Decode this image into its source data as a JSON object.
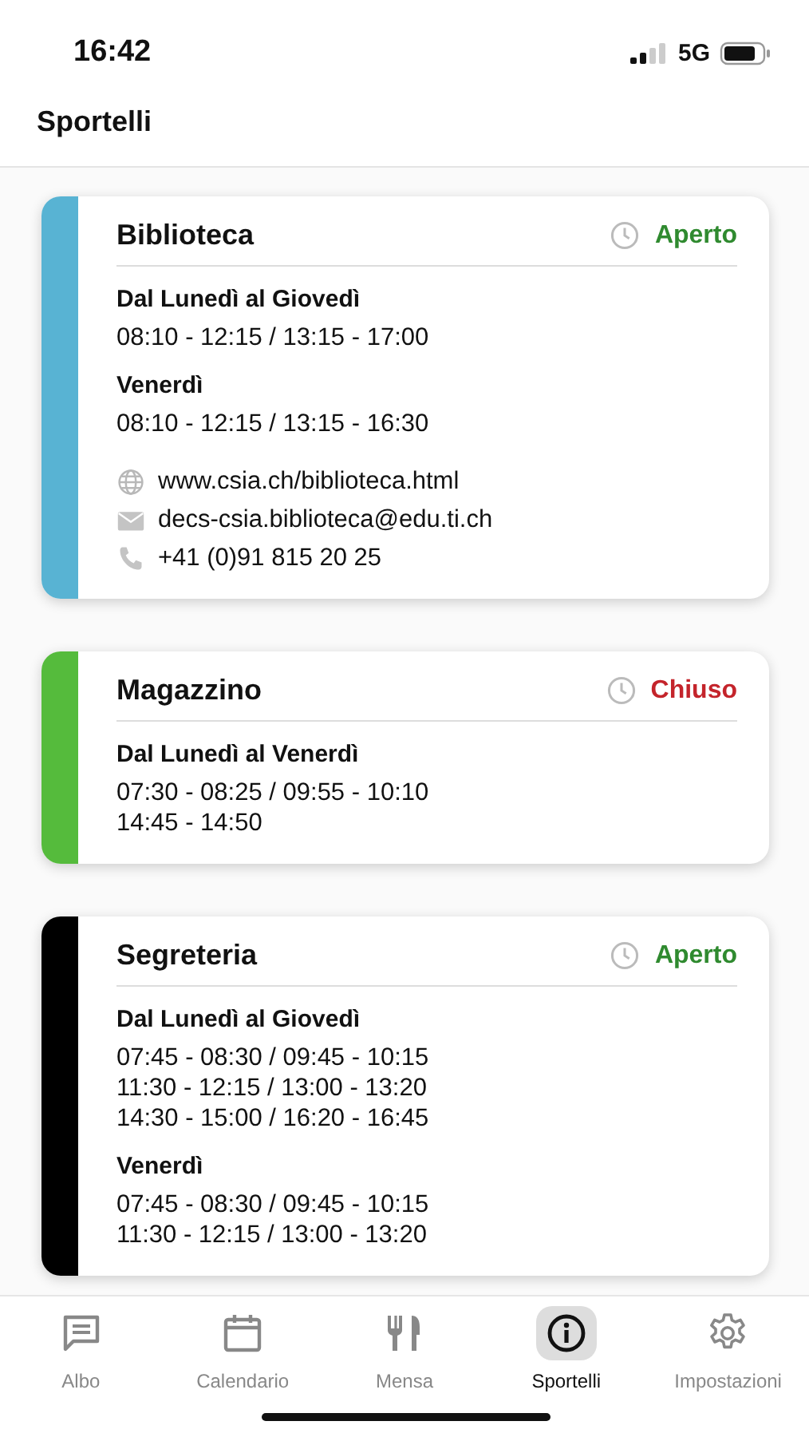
{
  "status_bar": {
    "time": "16:42",
    "network": "5G"
  },
  "header": {
    "title": "Sportelli"
  },
  "cards": [
    {
      "name": "Biblioteca",
      "color": "#58b3d3",
      "status": {
        "label": "Aperto",
        "open": true
      },
      "schedule": [
        {
          "days": "Dal Lunedì al Giovedì",
          "lines": [
            "08:10 - 12:15 / 13:15 - 17:00"
          ]
        },
        {
          "days": "Venerdì",
          "lines": [
            "08:10 - 12:15 / 13:15 - 16:30"
          ]
        }
      ],
      "contacts": [
        {
          "kind": "web",
          "text": "www.csia.ch/biblioteca.html"
        },
        {
          "kind": "email",
          "text": "decs-csia.biblioteca@edu.ti.ch"
        },
        {
          "kind": "phone",
          "text": "+41 (0)91 815 20 25"
        }
      ]
    },
    {
      "name": "Magazzino",
      "color": "#55bb3c",
      "status": {
        "label": "Chiuso",
        "open": false
      },
      "schedule": [
        {
          "days": "Dal Lunedì al Venerdì",
          "lines": [
            "07:30 - 08:25 / 09:55 - 10:10",
            "14:45 - 14:50"
          ]
        }
      ]
    },
    {
      "name": "Segreteria",
      "color": "#000000",
      "status": {
        "label": "Aperto",
        "open": true
      },
      "schedule": [
        {
          "days": "Dal Lunedì al Giovedì",
          "lines": [
            "07:45 - 08:30 / 09:45 - 10:15",
            "11:30 - 12:15 / 13:00 - 13:20",
            "14:30 - 15:00 / 16:20 - 16:45"
          ]
        },
        {
          "days": "Venerdì",
          "lines": [
            "07:45 - 08:30 / 09:45 - 10:15",
            "11:30 - 12:15 / 13:00 - 13:20"
          ]
        }
      ]
    }
  ],
  "tabs": [
    {
      "kind": "chat",
      "label": "Albo",
      "selected": false
    },
    {
      "kind": "calendar",
      "label": "Calendario",
      "selected": false
    },
    {
      "kind": "food",
      "label": "Mensa",
      "selected": false
    },
    {
      "kind": "info",
      "label": "Sportelli",
      "selected": true
    },
    {
      "kind": "gear",
      "label": "Impostazioni",
      "selected": false
    }
  ]
}
